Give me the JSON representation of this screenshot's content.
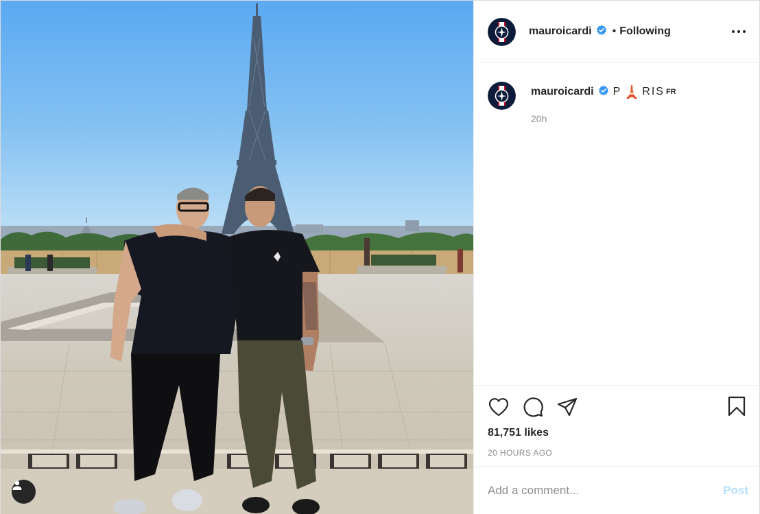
{
  "post": {
    "username": "mauroicardi",
    "follow_status": "Following",
    "separator": "•",
    "caption": {
      "username": "mauroicardi",
      "text_before": "P",
      "emoji_name": "tokyo-tower-emoji",
      "text_after": "RIS",
      "flag": "FR",
      "time": "20h"
    },
    "likes": "81,751 likes",
    "timestamp": "20 HOURS AGO",
    "comment": {
      "placeholder": "Add a comment...",
      "post_label": "Post"
    }
  },
  "icons": {
    "header": [
      "verified-badge-icon",
      "more-options-icon"
    ],
    "actions": [
      "heart-icon",
      "comment-icon",
      "share-icon",
      "bookmark-icon"
    ],
    "photo": [
      "user-tag-icon"
    ]
  },
  "colors": {
    "text": "#262626",
    "secondary": "#8e8e8e",
    "verified": "#3897f0",
    "post_button_disabled": "#b2dffc",
    "border": "#efefef"
  }
}
